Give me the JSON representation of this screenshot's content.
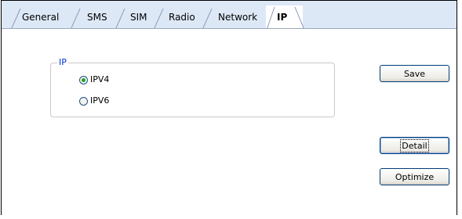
{
  "tabs": [
    {
      "label": "General",
      "active": false
    },
    {
      "label": "SMS",
      "active": false
    },
    {
      "label": "SIM",
      "active": false
    },
    {
      "label": "Radio",
      "active": false
    },
    {
      "label": "Network",
      "active": false
    },
    {
      "label": "IP",
      "active": true
    }
  ],
  "ip_group": {
    "legend": "IP",
    "options": [
      {
        "label": "IPV4",
        "checked": true
      },
      {
        "label": "IPV6",
        "checked": false
      }
    ]
  },
  "buttons": {
    "save": "Save",
    "detail": "Detail",
    "optimize": "Optimize"
  },
  "colors": {
    "tabbar_bg": "#dde8f7",
    "legend_text": "#0033cc",
    "radio_dot": "#21a121",
    "button_border": "#003c74"
  }
}
